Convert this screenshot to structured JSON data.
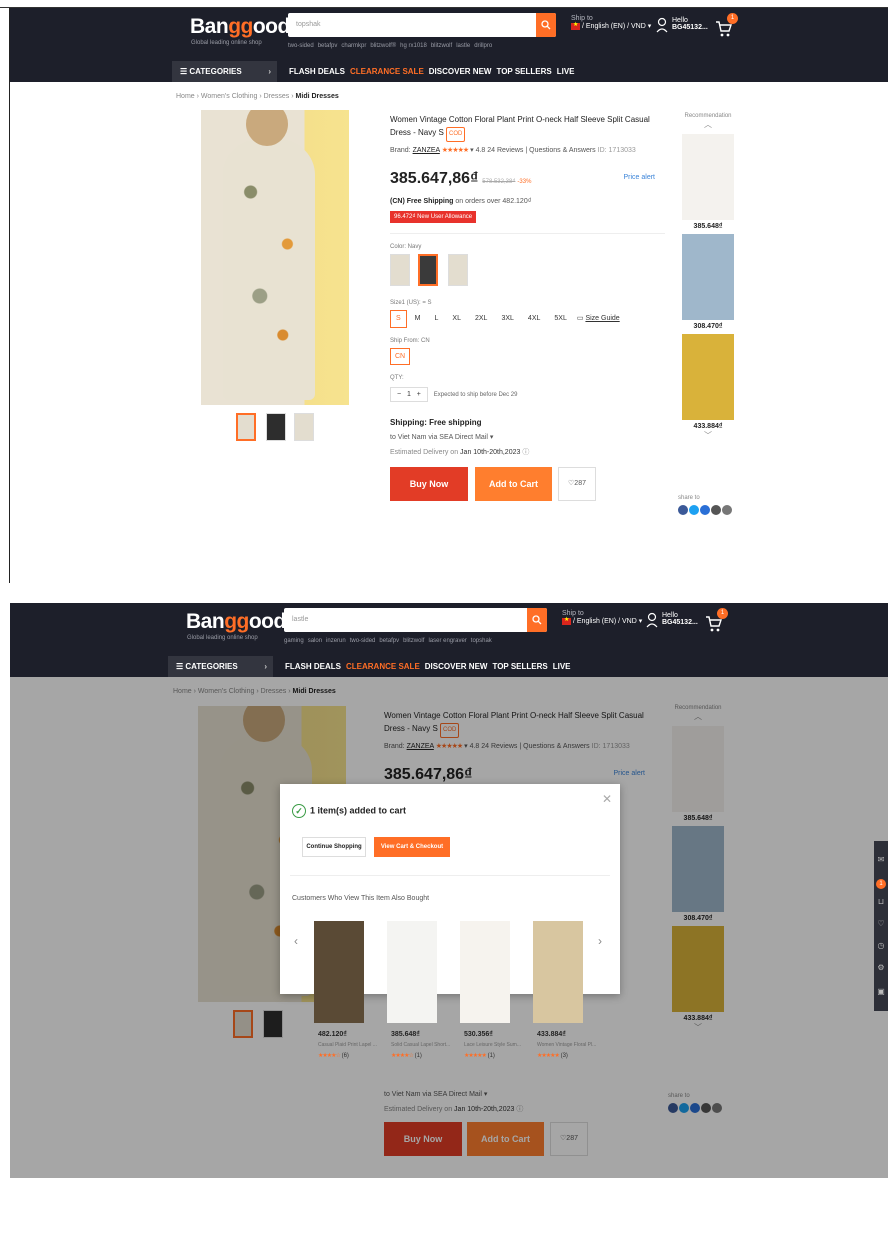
{
  "header": {
    "logo_left": "Ban",
    "logo_mid": "gg",
    "logo_right": "ood",
    "slogan": "Global leading online shop",
    "ship_to_label": "Ship to",
    "ship_to_value": "/ English (EN) / VND",
    "hello": "Hello",
    "user": "BG45132...",
    "cart_count": "1",
    "nav": {
      "categories": "CATEGORIES",
      "links": [
        "FLASH DEALS",
        "CLEARANCE SALE",
        "DISCOVER NEW",
        "TOP SELLERS",
        "LIVE"
      ]
    }
  },
  "shot1": {
    "search_placeholder": "topshak",
    "hot": [
      "two-sided",
      "betafpv",
      "charmkpr",
      "blitzwolf®",
      "hg rx1018",
      "blitzwolf",
      "lastle",
      "drillpro"
    ]
  },
  "shot2": {
    "search_placeholder": "lastle",
    "hot": [
      "gaming",
      "salon",
      "inzerun",
      "two-sided",
      "betafpv",
      "blitzwolf",
      "laser engraver",
      "topshak"
    ]
  },
  "breadcrumb": {
    "items": [
      "Home",
      "Women's Clothing",
      "Dresses"
    ],
    "current": "Midi Dresses"
  },
  "product": {
    "title": "Women Vintage Cotton Floral Plant Print O-neck Half Sleeve Split Casual Dress - Navy S",
    "cod": "COD",
    "brand_label": "Brand:",
    "brand": "ZANZEA",
    "stars": "★★★★★",
    "rating": "4.8",
    "reviews": "24 Reviews",
    "qa": "Questions & Answers",
    "id": "ID: 1713033",
    "price": "385.647,86₫",
    "old_price": "578.532,38₫",
    "discount": "-33%",
    "price_alert": "Price alert",
    "free_shipping_bold": "(CN) Free Shipping",
    "free_shipping_rest": " on orders over 482.120₫",
    "allowance": "96.472₫ New User Allowance",
    "color_label": "Color: Navy",
    "size_label": "Size1 (US): = S",
    "sizes": [
      "S",
      "M",
      "L",
      "XL",
      "2XL",
      "3XL",
      "4XL",
      "5XL"
    ],
    "size_guide": "Size Guide",
    "ship_from_label": "Ship From: CN",
    "ship_from_value": "CN",
    "qty_label": "QTY:",
    "qty_minus": "−",
    "qty_value": "1",
    "qty_plus": "+",
    "expected": "Expected to ship before Dec 29",
    "shipping_title": "Shipping: Free shipping",
    "shipping_to": "to Viet Nam via SEA Direct Mail",
    "delivery_label": "Estimated Delivery on",
    "delivery_value": "Jan 10th-20th,2023",
    "buy_now": "Buy Now",
    "add_to_cart": "Add to Cart",
    "wishlist_count": "287"
  },
  "recommendation": {
    "title": "Recommendation",
    "prices": [
      "385.648₫",
      "308.470₫",
      "433.884₫"
    ],
    "share": "share to"
  },
  "modal": {
    "added": "1 item(s) added to cart",
    "continue": "Continue Shopping",
    "view_cart": "View Cart & Checkout",
    "also_bought": "Customers Who View This Item Also Bought",
    "items": [
      {
        "price": "482.120₫",
        "name": "Casual Plaid Print Lapel ...",
        "stars": "★★★★☆",
        "count": "(6)"
      },
      {
        "price": "385.648₫",
        "name": "Solid Casual Lapel Short...",
        "stars": "★★★★☆",
        "count": "(1)"
      },
      {
        "price": "530.356₫",
        "name": "Lace Leisure Style Sum...",
        "stars": "★★★★★",
        "count": "(1)"
      },
      {
        "price": "433.884₫",
        "name": "Women Vintage Floral Pl...",
        "stars": "★★★★★",
        "count": "(3)"
      }
    ]
  },
  "colors": {
    "accent": "#ff6e26",
    "header_bg": "#1d1f2a",
    "buy": "#e23c26",
    "add": "#ff7e2e"
  }
}
